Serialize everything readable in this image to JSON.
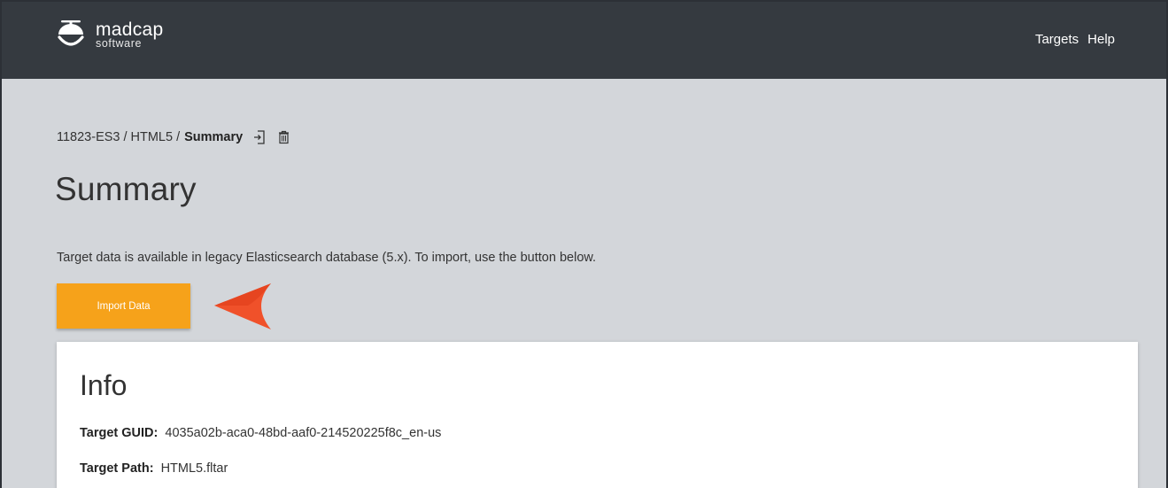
{
  "header": {
    "logo_name": "madcap",
    "logo_sub": "software",
    "nav": [
      "Targets",
      "Help"
    ]
  },
  "breadcrumb": {
    "items": [
      "11823-ES3",
      "HTML5"
    ],
    "separator": "/",
    "current": "Summary",
    "actions": [
      "import-icon",
      "trash-icon"
    ]
  },
  "page": {
    "title": "Summary",
    "notice": "Target data is available in legacy Elasticsearch database (5.x). To import, use the button below.",
    "import_button": "Import Data"
  },
  "info": {
    "title": "Info",
    "guid_label": "Target GUID:",
    "guid_value": "4035a02b-aca0-48bd-aaf0-214520225f8c_en-us",
    "path_label": "Target Path:",
    "path_value": "HTML5.fltar"
  },
  "colors": {
    "topbar": "#353a40",
    "background": "#d3d6da",
    "accent_button": "#f6a21a",
    "annotation_arrow": "#f0512a"
  }
}
